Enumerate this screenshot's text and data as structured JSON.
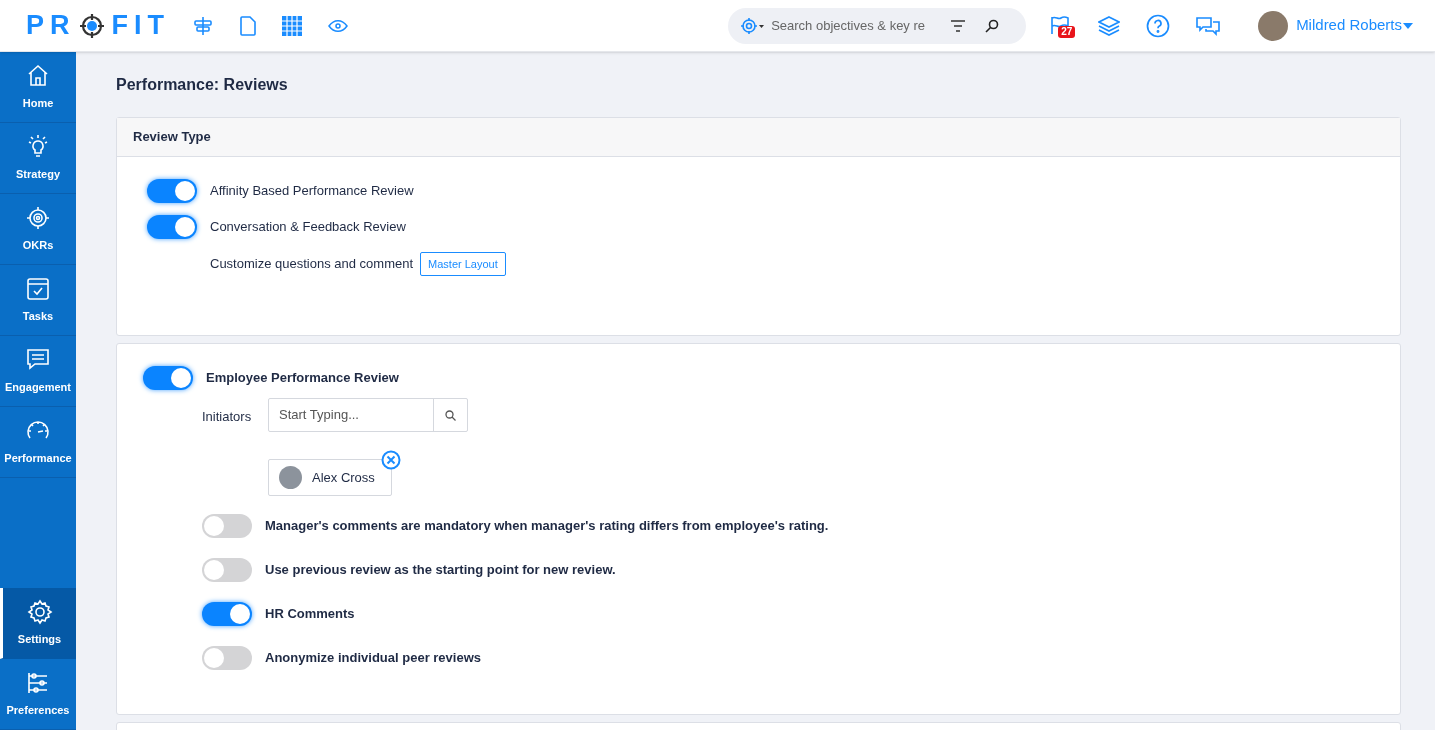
{
  "header": {
    "logo": {
      "left": "PR",
      "right": "FIT"
    },
    "search": {
      "placeholder": "Search objectives & key re"
    },
    "notifications_badge": "27",
    "user": {
      "name": "Mildred Roberts"
    }
  },
  "sidebar": {
    "items": [
      {
        "label": "Home",
        "selected": false
      },
      {
        "label": "Strategy",
        "selected": false
      },
      {
        "label": "OKRs",
        "selected": false
      },
      {
        "label": "Tasks",
        "selected": false
      },
      {
        "label": "Engagement",
        "selected": false
      },
      {
        "label": "Performance",
        "selected": false
      }
    ],
    "bottom_items": [
      {
        "label": "Settings",
        "selected": true
      },
      {
        "label": "Preferences",
        "selected": false
      }
    ]
  },
  "page_title": "Performance: Reviews",
  "review_type": {
    "title": "Review Type",
    "toggles": [
      {
        "label": "Affinity Based Performance Review",
        "on": true
      },
      {
        "label": "Conversation & Feedback Review",
        "on": true
      }
    ],
    "customize": {
      "label": "Customize questions and comment",
      "button": "Master Layout"
    }
  },
  "employee_review": {
    "toggle": {
      "label": "Employee Performance Review",
      "on": true
    },
    "initiators": {
      "label": "Initiators",
      "placeholder": "Start Typing...",
      "chips": [
        {
          "name": "Alex Cross"
        }
      ]
    },
    "options": [
      {
        "label": "Manager's comments are mandatory when manager's rating differs from employee's rating.",
        "on": false
      },
      {
        "label": "Use previous review as the starting point for new review.",
        "on": false
      },
      {
        "label": "HR Comments",
        "on": true
      },
      {
        "label": "Anonymize individual peer reviews",
        "on": false
      }
    ]
  }
}
